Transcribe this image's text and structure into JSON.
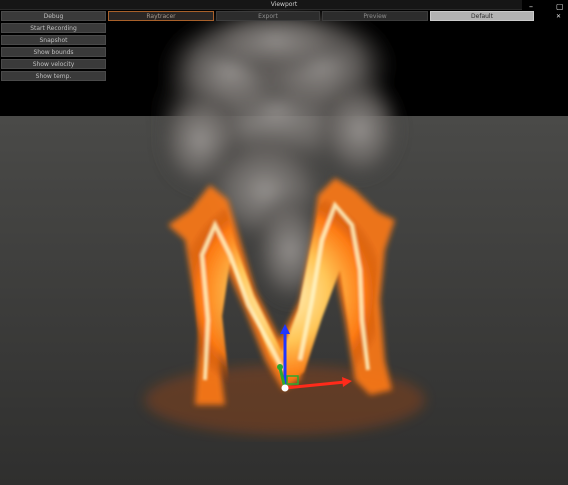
{
  "window": {
    "title": "Viewport"
  },
  "window_controls": {
    "minimize": "–",
    "maximize": "▢",
    "close": "✕"
  },
  "tabs": [
    {
      "label": "Raytracer",
      "state": "active"
    },
    {
      "label": "Export",
      "state": "normal"
    },
    {
      "label": "Preview",
      "state": "normal"
    },
    {
      "label": "Default",
      "state": "selected"
    }
  ],
  "menu": [
    {
      "label": "Debug"
    },
    {
      "label": "Start Recording"
    },
    {
      "label": "Snapshot"
    },
    {
      "label": "Show bounds"
    },
    {
      "label": "Show velocity"
    },
    {
      "label": "Show temp."
    }
  ],
  "colors": {
    "background": "#000000",
    "floor": "#3a3a38",
    "smoke": "#7d7a77",
    "fire_core": "#fff3b0",
    "fire_outer": "#ff8a1e",
    "gizmo_x": "#ff2a1a",
    "gizmo_y": "#2ea82e",
    "gizmo_z": "#1f36ff",
    "tab_active_border": "#a8602a",
    "tab_default_bg": "#b3b3b3"
  },
  "icons": {
    "minimize": "minimize-icon",
    "maximize": "maximize-icon",
    "close": "close-icon"
  }
}
